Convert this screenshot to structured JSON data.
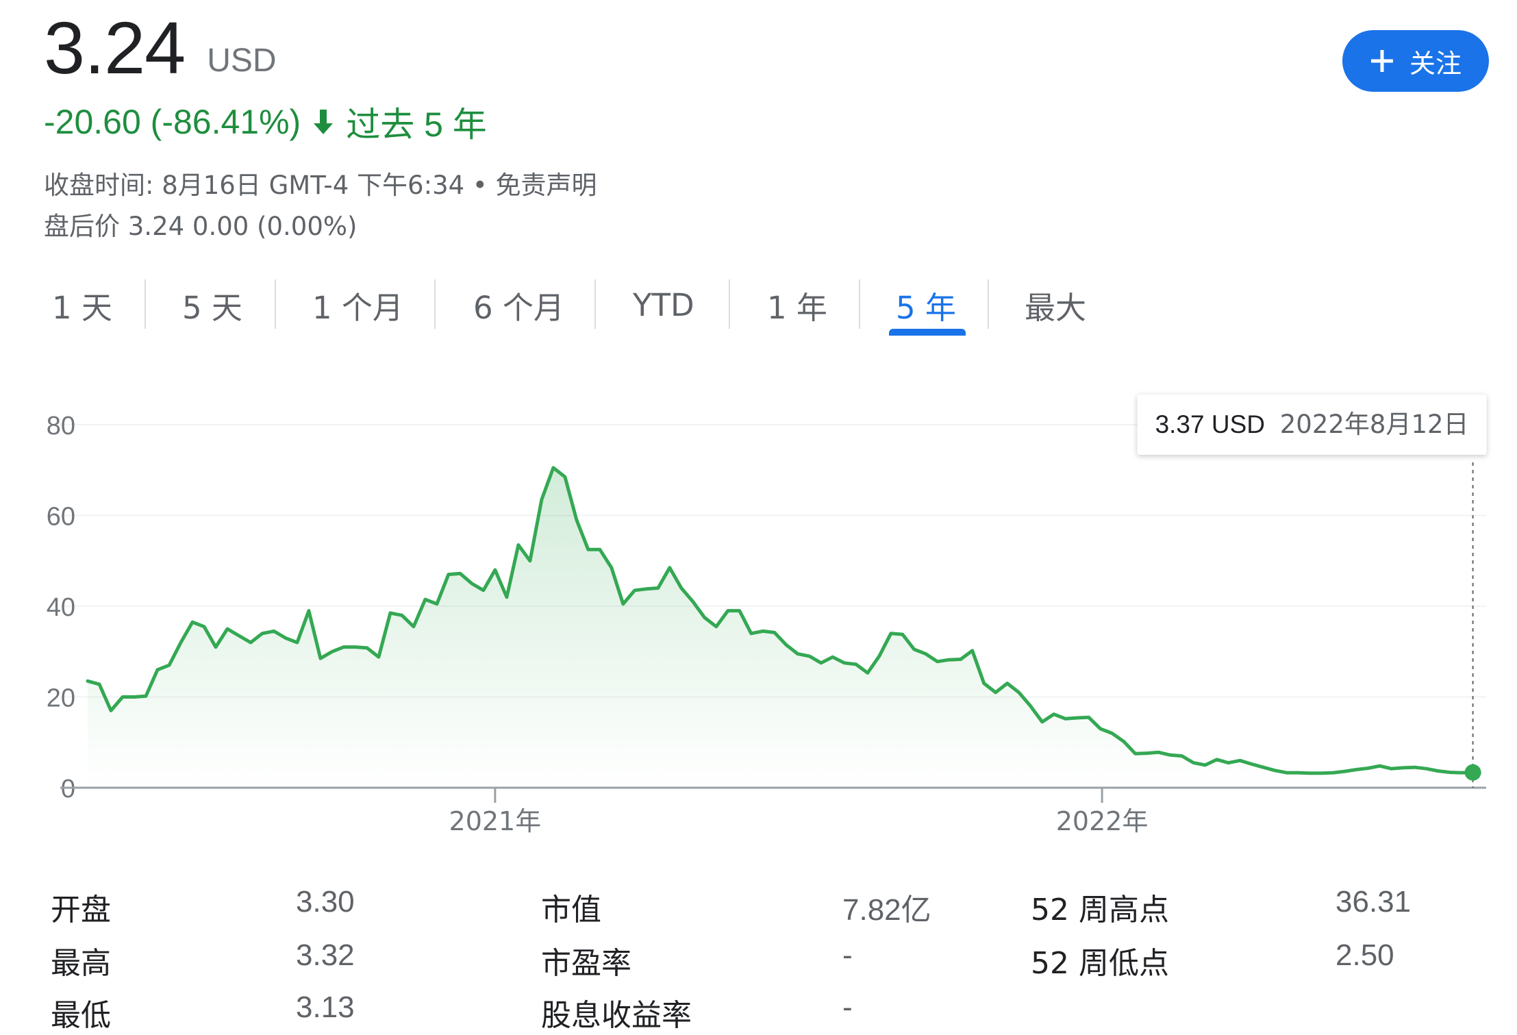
{
  "quote": {
    "price": "3.24",
    "currency": "USD",
    "change": "-20.60 (-86.41%)",
    "change_direction_icon": "arrow-down-icon",
    "period_label": "过去 5 年",
    "close_time": "收盘时间: 8月16日 GMT-4 下午6:34",
    "bullet": "•",
    "disclaimer": "免责声明",
    "after_hours": "盘后价 3.24 0.00 (0.00%)"
  },
  "follow_button": {
    "icon": "plus-icon",
    "label": "关注"
  },
  "tabs": [
    {
      "label": "1 天"
    },
    {
      "label": "5 天"
    },
    {
      "label": "1 个月"
    },
    {
      "label": "6 个月"
    },
    {
      "label": "YTD"
    },
    {
      "label": "1 年"
    },
    {
      "label": "5 年",
      "active": true
    },
    {
      "label": "最大"
    }
  ],
  "tooltip": {
    "value": "3.37 USD",
    "date": "2022年8月12日"
  },
  "colors": {
    "line": "#34a853",
    "accent": "#1a73e8",
    "down": "#1e8e3e",
    "grid": "#f1f3f4",
    "axis_text": "#70757a"
  },
  "chart_data": {
    "type": "area",
    "title": "",
    "xlabel": "",
    "ylabel": "",
    "ylim": [
      0,
      80
    ],
    "y_ticks": [
      0,
      20,
      40,
      60,
      80
    ],
    "x_ticks": [
      {
        "label": "2021年",
        "x": "2021-01-01"
      },
      {
        "label": "2022年",
        "x": "2022-01-01"
      }
    ],
    "grid": true,
    "x_range": [
      "2020-05-01",
      "2022-08-20"
    ],
    "series": [
      {
        "x": [
          "2020-05-01",
          "2020-05-08",
          "2020-05-15",
          "2020-05-22",
          "2020-05-29",
          "2020-06-05",
          "2020-06-12",
          "2020-06-19",
          "2020-06-26",
          "2020-07-03",
          "2020-07-10",
          "2020-07-17",
          "2020-07-24",
          "2020-07-31",
          "2020-08-07",
          "2020-08-14",
          "2020-08-21",
          "2020-08-28",
          "2020-09-04",
          "2020-09-11",
          "2020-09-18",
          "2020-09-25",
          "2020-10-02",
          "2020-10-09",
          "2020-10-16",
          "2020-10-23",
          "2020-10-30",
          "2020-11-06",
          "2020-11-13",
          "2020-11-20",
          "2020-11-27",
          "2020-12-04",
          "2020-12-11",
          "2020-12-18",
          "2020-12-25",
          "2021-01-01",
          "2021-01-08",
          "2021-01-15",
          "2021-01-22",
          "2021-01-29",
          "2021-02-05",
          "2021-02-12",
          "2021-02-19",
          "2021-02-26",
          "2021-03-05",
          "2021-03-12",
          "2021-03-19",
          "2021-03-26",
          "2021-04-02",
          "2021-04-09",
          "2021-04-16",
          "2021-04-23",
          "2021-04-30",
          "2021-05-07",
          "2021-05-14",
          "2021-05-21",
          "2021-05-28",
          "2021-06-04",
          "2021-06-11",
          "2021-06-18",
          "2021-06-25",
          "2021-07-02",
          "2021-07-09",
          "2021-07-16",
          "2021-07-23",
          "2021-07-30",
          "2021-08-06",
          "2021-08-13",
          "2021-08-20",
          "2021-08-27",
          "2021-09-03",
          "2021-09-10",
          "2021-09-17",
          "2021-09-24",
          "2021-10-01",
          "2021-10-08",
          "2021-10-15",
          "2021-10-22",
          "2021-10-29",
          "2021-11-05",
          "2021-11-12",
          "2021-11-19",
          "2021-11-26",
          "2021-12-03",
          "2021-12-10",
          "2021-12-17",
          "2021-12-24",
          "2021-12-31",
          "2022-01-07",
          "2022-01-14",
          "2022-01-21",
          "2022-01-28",
          "2022-02-04",
          "2022-02-11",
          "2022-02-18",
          "2022-02-25",
          "2022-03-04",
          "2022-03-11",
          "2022-03-18",
          "2022-03-25",
          "2022-04-01",
          "2022-04-08",
          "2022-04-15",
          "2022-04-22",
          "2022-04-29",
          "2022-05-06",
          "2022-05-13",
          "2022-05-20",
          "2022-05-27",
          "2022-06-03",
          "2022-06-10",
          "2022-06-17",
          "2022-06-24",
          "2022-07-01",
          "2022-07-08",
          "2022-07-15",
          "2022-07-22",
          "2022-07-29",
          "2022-08-05",
          "2022-08-12",
          "2022-08-16"
        ],
        "values": [
          23.5,
          22.8,
          17.0,
          20.0,
          20.0,
          20.2,
          26.0,
          27.0,
          32.0,
          36.5,
          35.5,
          31.0,
          35.0,
          33.5,
          32.0,
          34.0,
          34.5,
          33.0,
          32.0,
          39.0,
          28.5,
          30.0,
          31.0,
          31.0,
          30.8,
          28.8,
          38.5,
          38.0,
          35.5,
          41.5,
          40.5,
          47.0,
          47.2,
          45.0,
          43.5,
          48.0,
          42.0,
          53.5,
          50.0,
          63.5,
          70.5,
          68.5,
          59.0,
          52.5,
          52.5,
          48.5,
          40.5,
          43.5,
          43.8,
          44.0,
          48.5,
          44.0,
          41.0,
          37.5,
          35.5,
          39.0,
          39.0,
          34.0,
          34.5,
          34.2,
          31.5,
          29.5,
          29.0,
          27.5,
          28.8,
          27.5,
          27.2,
          25.3,
          29.0,
          34.0,
          33.8,
          30.5,
          29.5,
          27.8,
          28.2,
          28.3,
          30.2,
          23.0,
          21.0,
          23.0,
          21.0,
          18.0,
          14.5,
          16.2,
          15.2,
          15.4,
          15.5,
          13.0,
          12.0,
          10.2,
          7.5,
          7.6,
          7.8,
          7.2,
          7.0,
          5.5,
          5.0,
          6.2,
          5.5,
          6.0,
          5.2,
          4.5,
          3.8,
          3.3,
          3.3,
          3.2,
          3.2,
          3.3,
          3.6,
          4.0,
          4.3,
          4.8,
          4.2,
          4.4,
          4.5,
          4.2,
          3.7,
          3.4,
          3.3,
          3.37,
          3.24
        ]
      }
    ]
  },
  "stats": [
    {
      "label": "开盘",
      "value": "3.30"
    },
    {
      "label": "最高",
      "value": "3.32"
    },
    {
      "label": "最低",
      "value": "3.13"
    },
    {
      "label": "市值",
      "value": "7.82亿"
    },
    {
      "label": "市盈率",
      "value": "-"
    },
    {
      "label": "股息收益率",
      "value": "-"
    },
    {
      "label": "52 周高点",
      "value": "36.31"
    },
    {
      "label": "52 周低点",
      "value": "2.50"
    }
  ]
}
